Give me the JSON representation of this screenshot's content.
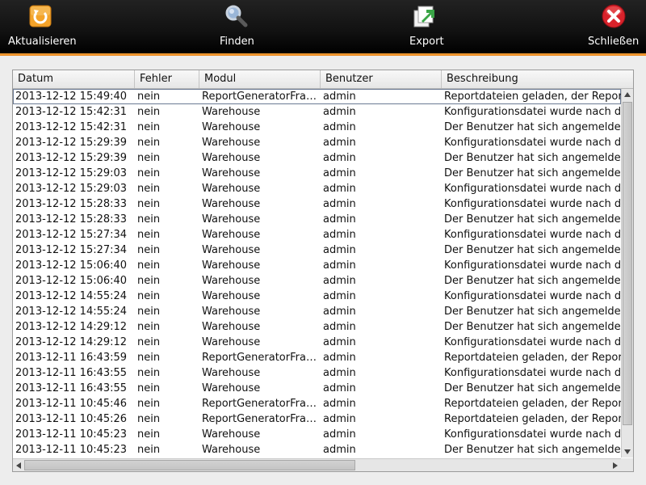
{
  "toolbar": {
    "buttons": [
      {
        "id": "refresh",
        "label": "Aktualisieren",
        "icon": "refresh-icon"
      },
      {
        "id": "find",
        "label": "Finden",
        "icon": "magnifier-icon"
      },
      {
        "id": "export",
        "label": "Export",
        "icon": "export-icon"
      },
      {
        "id": "close",
        "label": "Schließen",
        "icon": "close-icon"
      }
    ],
    "accent_color": "#f0962a"
  },
  "table": {
    "columns": [
      "Datum",
      "Fehler",
      "Modul",
      "Benutzer",
      "Beschreibung"
    ],
    "rows": [
      [
        "2013-12-12 15:49:40",
        "nein",
        "ReportGeneratorFra…",
        "admin",
        "Reportdateien geladen, der Report"
      ],
      [
        "2013-12-12 15:42:31",
        "nein",
        "Warehouse",
        "admin",
        "Konfigurationsdatei wurde nach de"
      ],
      [
        "2013-12-12 15:42:31",
        "nein",
        "Warehouse",
        "admin",
        "Der Benutzer hat sich angemeldet"
      ],
      [
        "2013-12-12 15:29:39",
        "nein",
        "Warehouse",
        "admin",
        "Konfigurationsdatei wurde nach de"
      ],
      [
        "2013-12-12 15:29:39",
        "nein",
        "Warehouse",
        "admin",
        "Der Benutzer hat sich angemeldet"
      ],
      [
        "2013-12-12 15:29:03",
        "nein",
        "Warehouse",
        "admin",
        "Der Benutzer hat sich angemeldet"
      ],
      [
        "2013-12-12 15:29:03",
        "nein",
        "Warehouse",
        "admin",
        "Konfigurationsdatei wurde nach de"
      ],
      [
        "2013-12-12 15:28:33",
        "nein",
        "Warehouse",
        "admin",
        "Konfigurationsdatei wurde nach de"
      ],
      [
        "2013-12-12 15:28:33",
        "nein",
        "Warehouse",
        "admin",
        "Der Benutzer hat sich angemeldet"
      ],
      [
        "2013-12-12 15:27:34",
        "nein",
        "Warehouse",
        "admin",
        "Konfigurationsdatei wurde nach de"
      ],
      [
        "2013-12-12 15:27:34",
        "nein",
        "Warehouse",
        "admin",
        "Der Benutzer hat sich angemeldet"
      ],
      [
        "2013-12-12 15:06:40",
        "nein",
        "Warehouse",
        "admin",
        "Konfigurationsdatei wurde nach de"
      ],
      [
        "2013-12-12 15:06:40",
        "nein",
        "Warehouse",
        "admin",
        "Der Benutzer hat sich angemeldet"
      ],
      [
        "2013-12-12 14:55:24",
        "nein",
        "Warehouse",
        "admin",
        "Konfigurationsdatei wurde nach de"
      ],
      [
        "2013-12-12 14:55:24",
        "nein",
        "Warehouse",
        "admin",
        "Der Benutzer hat sich angemeldet"
      ],
      [
        "2013-12-12 14:29:12",
        "nein",
        "Warehouse",
        "admin",
        "Der Benutzer hat sich angemeldet"
      ],
      [
        "2013-12-12 14:29:12",
        "nein",
        "Warehouse",
        "admin",
        "Konfigurationsdatei wurde nach de"
      ],
      [
        "2013-12-11 16:43:59",
        "nein",
        "ReportGeneratorFra…",
        "admin",
        "Reportdateien geladen, der Report"
      ],
      [
        "2013-12-11 16:43:55",
        "nein",
        "Warehouse",
        "admin",
        "Konfigurationsdatei wurde nach de"
      ],
      [
        "2013-12-11 16:43:55",
        "nein",
        "Warehouse",
        "admin",
        "Der Benutzer hat sich angemeldet"
      ],
      [
        "2013-12-11 10:45:46",
        "nein",
        "ReportGeneratorFra…",
        "admin",
        "Reportdateien geladen, der Report"
      ],
      [
        "2013-12-11 10:45:26",
        "nein",
        "ReportGeneratorFra…",
        "admin",
        "Reportdateien geladen, der Report"
      ],
      [
        "2013-12-11 10:45:23",
        "nein",
        "Warehouse",
        "admin",
        "Konfigurationsdatei wurde nach de"
      ],
      [
        "2013-12-11 10:45:23",
        "nein",
        "Warehouse",
        "admin",
        "Der Benutzer hat sich angemeldet"
      ]
    ],
    "selected_row": 0
  }
}
